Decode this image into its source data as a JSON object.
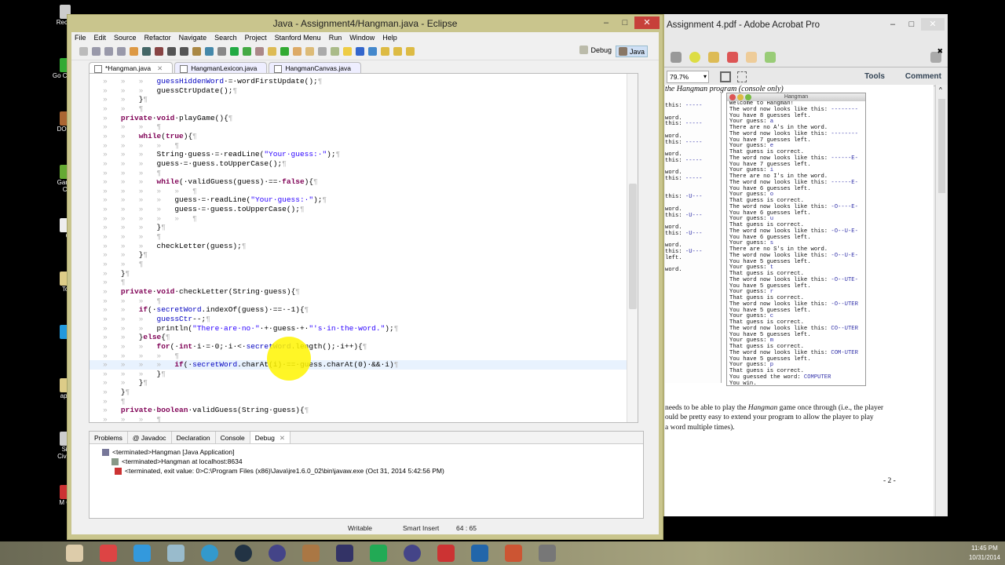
{
  "desktop": {
    "icons": [
      {
        "label": "Recy",
        "color": "#ccc"
      },
      {
        "label": "Go Ch",
        "color": "#3a3"
      },
      {
        "label": "DOS",
        "color": "#a63"
      },
      {
        "label": "Gam Ce",
        "color": "#6a3"
      },
      {
        "label": "Q",
        "color": "#eee"
      },
      {
        "label": "Tor",
        "color": "#dc8"
      },
      {
        "label": "S",
        "color": "#29d"
      },
      {
        "label": "app",
        "color": "#dc8"
      },
      {
        "label": "Sid Civili",
        "color": "#ccc"
      },
      {
        "label": "M C",
        "color": "#c33"
      }
    ]
  },
  "eclipse": {
    "title": "Java - Assignment4/Hangman.java - Eclipse",
    "menu": [
      "File",
      "Edit",
      "Source",
      "Refactor",
      "Navigate",
      "Search",
      "Project",
      "Stanford Menu",
      "Run",
      "Window",
      "Help"
    ],
    "perspectives": {
      "debug": "Debug",
      "java": "Java"
    },
    "tabs": [
      {
        "label": "*Hangman.java",
        "active": true,
        "close": "✕"
      },
      {
        "label": "HangmanLexicon.java"
      },
      {
        "label": "HangmanCanvas.java"
      }
    ],
    "code": [
      {
        "i": 2,
        "s": [
          [
            "fd",
            "guessHiddenWord"
          ],
          [
            "",
            "·=·wordFirstUpdate();"
          ]
        ]
      },
      {
        "i": 2,
        "s": [
          [
            "",
            "guessCtrUpdate();"
          ]
        ]
      },
      {
        "i": 1,
        "s": [
          [
            "",
            "}"
          ]
        ]
      },
      {
        "i": 1,
        "s": []
      },
      {
        "i": 0,
        "s": [
          [
            "kw",
            "private"
          ],
          [
            "",
            "·"
          ],
          [
            "kw",
            "void"
          ],
          [
            "",
            "·playGame(){"
          ]
        ]
      },
      {
        "i": 2,
        "s": []
      },
      {
        "i": 1,
        "s": [
          [
            "kw",
            "while"
          ],
          [
            "",
            "("
          ],
          [
            "kw",
            "true"
          ],
          [
            "",
            "){"
          ]
        ]
      },
      {
        "i": 3,
        "s": []
      },
      {
        "i": 2,
        "s": [
          [
            "",
            "String·guess·=·readLine("
          ],
          [
            "st",
            "\"Your·guess:·\""
          ],
          [
            "",
            ");"
          ]
        ]
      },
      {
        "i": 2,
        "s": [
          [
            "",
            "guess·=·guess.toUpperCase();"
          ]
        ]
      },
      {
        "i": 2,
        "s": []
      },
      {
        "i": 2,
        "s": [
          [
            "kw",
            "while"
          ],
          [
            "",
            "(·validGuess(guess)·==·"
          ],
          [
            "kw",
            "false"
          ],
          [
            "",
            "){"
          ]
        ]
      },
      {
        "i": 4,
        "s": []
      },
      {
        "i": 3,
        "s": [
          [
            "",
            "guess·=·readLine("
          ],
          [
            "st",
            "\"Your·guess:·\""
          ],
          [
            "",
            ");"
          ]
        ]
      },
      {
        "i": 3,
        "s": [
          [
            "",
            "guess·=·guess.toUpperCase();"
          ]
        ]
      },
      {
        "i": 4,
        "s": []
      },
      {
        "i": 2,
        "s": [
          [
            "",
            "}"
          ]
        ]
      },
      {
        "i": 2,
        "s": []
      },
      {
        "i": 2,
        "s": [
          [
            "",
            "checkLetter(guess);"
          ]
        ]
      },
      {
        "i": 1,
        "s": [
          [
            "",
            "}"
          ]
        ]
      },
      {
        "i": 1,
        "s": []
      },
      {
        "i": 0,
        "s": [
          [
            "",
            "}"
          ]
        ]
      },
      {
        "i": 0,
        "s": []
      },
      {
        "i": 0,
        "s": [
          [
            "kw",
            "private"
          ],
          [
            "",
            "·"
          ],
          [
            "kw",
            "void"
          ],
          [
            "",
            "·checkLetter(String·guess){"
          ]
        ]
      },
      {
        "i": 2,
        "s": []
      },
      {
        "i": 1,
        "s": [
          [
            "kw",
            "if"
          ],
          [
            "",
            "(·"
          ],
          [
            "fd",
            "secretWord"
          ],
          [
            "",
            ".indexOf(guess)·==·-1){"
          ]
        ]
      },
      {
        "i": 2,
        "s": [
          [
            "fd",
            "guessCtr"
          ],
          [
            "",
            "--;"
          ]
        ]
      },
      {
        "i": 2,
        "s": [
          [
            "",
            "println("
          ],
          [
            "st",
            "\"There·are·no·\""
          ],
          [
            "",
            "·+·guess·+·"
          ],
          [
            "st",
            "\"'s·in·the·word.\""
          ],
          [
            "",
            ");"
          ]
        ]
      },
      {
        "i": 1,
        "s": [
          [
            "",
            "}"
          ],
          [
            "kw",
            "else"
          ],
          [
            "",
            "{"
          ]
        ]
      },
      {
        "i": 2,
        "s": [
          [
            "kw",
            "for"
          ],
          [
            "",
            "(·"
          ],
          [
            "kw",
            "int"
          ],
          [
            "",
            "·i·=·0;·i·<·"
          ],
          [
            "fd",
            "secretWord"
          ],
          [
            "",
            ".length();·i++){"
          ]
        ]
      },
      {
        "i": 3,
        "s": []
      },
      {
        "i": 3,
        "s": [
          [
            "kw",
            "if"
          ],
          [
            "",
            "(·"
          ],
          [
            "fd",
            "secretWord"
          ],
          [
            "",
            ".charAt(i)·==·guess.charAt(0)·&&·i)"
          ]
        ],
        "current": true
      },
      {
        "i": 2,
        "s": [
          [
            "",
            "}"
          ]
        ]
      },
      {
        "i": 1,
        "s": [
          [
            "",
            "}"
          ]
        ]
      },
      {
        "i": 0,
        "s": [
          [
            "",
            "}"
          ]
        ]
      },
      {
        "i": 0,
        "s": []
      },
      {
        "i": 0,
        "s": [
          [
            "kw",
            "private"
          ],
          [
            "",
            "·"
          ],
          [
            "kw",
            "boolean"
          ],
          [
            "",
            "·validGuess(String·guess){"
          ]
        ]
      },
      {
        "i": 2,
        "s": []
      }
    ],
    "bottom_tabs": [
      {
        "label": "Problems"
      },
      {
        "label": "@ Javadoc"
      },
      {
        "label": "Declaration"
      },
      {
        "label": "Console"
      },
      {
        "label": "Debug",
        "active": true,
        "close": "✕"
      }
    ],
    "debug_tree": [
      "<terminated>Hangman [Java Application]",
      "<terminated>Hangman at localhost:8634",
      "<terminated, exit value: 0>C:\\Program Files (x86)\\Java\\jre1.6.0_02\\bin\\javaw.exe (Oct 31, 2014 5:42:56 PM)"
    ],
    "status": {
      "mode": "Writable",
      "insert": "Smart Insert",
      "position": "64 : 65"
    }
  },
  "acrobat": {
    "title": "Assignment 4.pdf - Adobe Acrobat Pro",
    "zoom": "79.7%",
    "tools": "Tools",
    "comment": "Comment",
    "caption": "the Hangman program (console only)",
    "left_clip": [
      [
        "this: ",
        "-----"
      ],
      [
        "",
        ""
      ],
      [
        "word.",
        ""
      ],
      [
        "this: ",
        "-----"
      ],
      [
        "",
        ""
      ],
      [
        "word.",
        ""
      ],
      [
        "this: ",
        "-----"
      ],
      [
        "",
        ""
      ],
      [
        "word.",
        ""
      ],
      [
        "this: ",
        "-----"
      ],
      [
        "",
        ""
      ],
      [
        "word.",
        ""
      ],
      [
        "this: ",
        "-----"
      ],
      [
        "",
        ""
      ],
      [
        "",
        ""
      ],
      [
        "this: ",
        "-U---"
      ],
      [
        "",
        ""
      ],
      [
        "word.",
        ""
      ],
      [
        "this: ",
        "-U---"
      ],
      [
        "",
        ""
      ],
      [
        "word.",
        ""
      ],
      [
        "this: ",
        "-U---"
      ],
      [
        "",
        ""
      ],
      [
        "word.",
        ""
      ],
      [
        "this: ",
        "-U---"
      ],
      [
        "left.",
        ""
      ],
      [
        "",
        ""
      ],
      [
        "word.",
        ""
      ]
    ],
    "window_title": "Hangman",
    "console": [
      [
        "Welcome to Hangman!",
        ""
      ],
      [
        "The word now looks like this: ",
        "--------"
      ],
      [
        "You have 8 guesses left.",
        ""
      ],
      [
        "Your guess: ",
        "a"
      ],
      [
        "There are no A's in the word.",
        ""
      ],
      [
        "The word now looks like this: ",
        "--------"
      ],
      [
        "You have 7 guesses left.",
        ""
      ],
      [
        "Your guess: ",
        "e"
      ],
      [
        "That guess is correct.",
        ""
      ],
      [
        "The word now looks like this: ",
        "------E-"
      ],
      [
        "You have 7 guesses left.",
        ""
      ],
      [
        "Your guess: ",
        "i"
      ],
      [
        "There are no I's in the word.",
        ""
      ],
      [
        "The word now looks like this: ",
        "------E-"
      ],
      [
        "You have 6 guesses left.",
        ""
      ],
      [
        "Your guess: ",
        "o"
      ],
      [
        "That guess is correct.",
        ""
      ],
      [
        "The word now looks like this: ",
        "-O----E-"
      ],
      [
        "You have 6 guesses left.",
        ""
      ],
      [
        "Your guess: ",
        "u"
      ],
      [
        "That guess is correct.",
        ""
      ],
      [
        "The word now looks like this: ",
        "-O--U-E-"
      ],
      [
        "You have 6 guesses left.",
        ""
      ],
      [
        "Your guess: ",
        "s"
      ],
      [
        "There are no S's in the word.",
        ""
      ],
      [
        "The word now looks like this: ",
        "-O--U-E-"
      ],
      [
        "You have 5 guesses left.",
        ""
      ],
      [
        "Your guess: ",
        "t"
      ],
      [
        "That guess is correct.",
        ""
      ],
      [
        "The word now looks like this: ",
        "-O--UTE-"
      ],
      [
        "You have 5 guesses left.",
        ""
      ],
      [
        "Your guess: ",
        "r"
      ],
      [
        "That guess is correct.",
        ""
      ],
      [
        "The word now looks like this: ",
        "-O--UTER"
      ],
      [
        "You have 5 guesses left.",
        ""
      ],
      [
        "Your guess: ",
        "c"
      ],
      [
        "That guess is correct.",
        ""
      ],
      [
        "The word now looks like this: ",
        "CO--UTER"
      ],
      [
        "You have 5 guesses left.",
        ""
      ],
      [
        "Your guess: ",
        "m"
      ],
      [
        "That guess is correct.",
        ""
      ],
      [
        "The word now looks like this: ",
        "COM-UTER"
      ],
      [
        "You have 5 guesses left.",
        ""
      ],
      [
        "Your guess: ",
        "p"
      ],
      [
        "That guess is correct.",
        ""
      ],
      [
        "You guessed the word: ",
        "COMPUTER"
      ],
      [
        "You win.",
        ""
      ]
    ],
    "paragraph": {
      "l1a": "needs to be able to play the ",
      "l1i": "Hangman",
      "l1b": " game once through (i.e., the player",
      "l2": "ould be pretty easy to extend your program to allow the player to play",
      "l3": " a word multiple times)."
    },
    "page_number": "- 2 -"
  },
  "taskbar": {
    "apps": [
      "file-explorer",
      "chrome",
      "internet-explorer",
      "notepad",
      "itunes",
      "steam",
      "eclipse",
      "dosbox",
      "calculator",
      "excel",
      "eclipse-2",
      "acrobat",
      "word",
      "powerpoint",
      "snipping-tool"
    ],
    "time": "11:45 PM",
    "date": "10/31/2014"
  }
}
